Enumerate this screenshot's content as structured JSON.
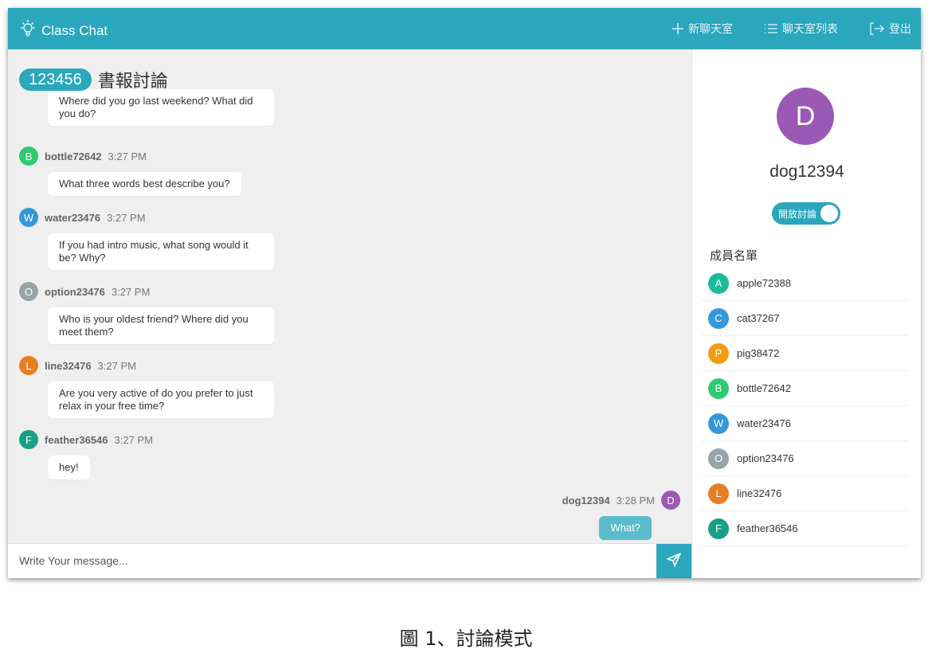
{
  "navbar": {
    "brand": "Class Chat",
    "new_room": "新聊天室",
    "room_list": "聊天室列表",
    "logout": "登出"
  },
  "room": {
    "id": "123456",
    "name": "書報討論"
  },
  "messages": [
    {
      "text": "Where did you go last weekend? What did you do?",
      "partial": true
    },
    {
      "user": "bottle72642",
      "initial": "B",
      "time": "3:27 PM",
      "color": "#2ecc71",
      "text": "What three words best describe you?"
    },
    {
      "user": "water23476",
      "initial": "W",
      "time": "3:27 PM",
      "color": "#3498db",
      "text": "If you had intro music, what song would it be? Why?"
    },
    {
      "user": "option23476",
      "initial": "O",
      "time": "3:27 PM",
      "color": "#95a5a6",
      "text": "Who is your oldest friend? Where did you meet them?"
    },
    {
      "user": "line32476",
      "initial": "L",
      "time": "3:27 PM",
      "color": "#e67e22",
      "text": "Are you very active of do you prefer to just relax in your free time?"
    },
    {
      "user": "feather36546",
      "initial": "F",
      "time": "3:27 PM",
      "color": "#16a085",
      "text": "hey!"
    }
  ],
  "my_message": {
    "user": "dog12394",
    "initial": "D",
    "time": "3:28 PM",
    "color": "#9b59b6",
    "text": "What?"
  },
  "composer": {
    "placeholder": "Write Your message..."
  },
  "profile": {
    "initial": "D",
    "name": "dog12394",
    "color": "#9b59b6",
    "toggle_label": "開放討論"
  },
  "members_title": "成員名單",
  "members": [
    {
      "initial": "A",
      "name": "apple72388",
      "color": "#1abc9c"
    },
    {
      "initial": "C",
      "name": "cat37267",
      "color": "#3498db"
    },
    {
      "initial": "P",
      "name": "pig38472",
      "color": "#f39c12"
    },
    {
      "initial": "B",
      "name": "bottle72642",
      "color": "#2ecc71"
    },
    {
      "initial": "W",
      "name": "water23476",
      "color": "#3498db"
    },
    {
      "initial": "O",
      "name": "option23476",
      "color": "#95a5a6"
    },
    {
      "initial": "L",
      "name": "line32476",
      "color": "#e67e22"
    },
    {
      "initial": "F",
      "name": "feather36546",
      "color": "#16a085"
    }
  ],
  "caption": "圖 1、討論模式"
}
